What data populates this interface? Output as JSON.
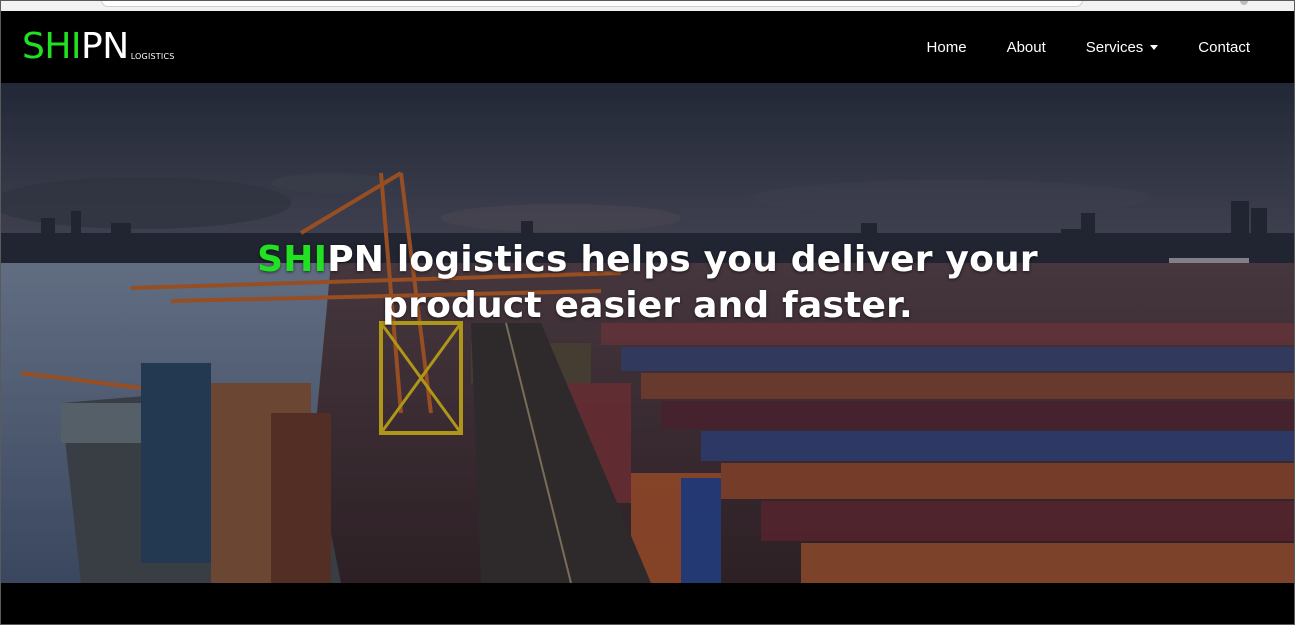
{
  "brand": {
    "highlight": "SHI",
    "rest": "PN",
    "sub": "LOGISTICS"
  },
  "nav": {
    "items": [
      {
        "label": "Home"
      },
      {
        "label": "About"
      },
      {
        "label": "Services",
        "dropdown": true
      },
      {
        "label": "Contact"
      }
    ]
  },
  "hero": {
    "headline_highlight": "SHI",
    "headline_line1_rest": "PN logistics helps you deliver your",
    "headline_line2": "product easier and faster.",
    "background_image": "container-port-at-dusk"
  },
  "colors": {
    "accent": "#22e022",
    "nav_bg": "#000000",
    "text": "#ffffff"
  }
}
